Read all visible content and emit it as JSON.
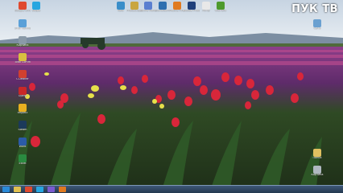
{
  "watermark": "ПУК ТВ",
  "desktop_icons_top": [
    {
      "label": "Google Chrome",
      "icon": "chrome-icon",
      "color": "#e04a2f"
    },
    {
      "label": "Skype",
      "icon": "skype-icon",
      "color": "#27a6e0"
    },
    {
      "label": "Kodi",
      "icon": "kodi-icon",
      "color": "#3a8ec9"
    },
    {
      "label": "Photoscape",
      "icon": "photoscape-icon",
      "color": "#c9a640"
    },
    {
      "label": "Movie Maker",
      "icon": "movie-maker-icon",
      "color": "#5a7fd0"
    },
    {
      "label": "Bandicam",
      "icon": "bandicam-icon",
      "color": "#2e6fb0"
    },
    {
      "label": "Mozilla Firefox",
      "icon": "firefox-icon",
      "color": "#e07a20"
    },
    {
      "label": "Adobe Photoshop",
      "icon": "photoshop-icon",
      "color": "#1f3f7a"
    },
    {
      "label": "Aimp",
      "icon": "aimp-icon",
      "color": "#e8e8e8"
    },
    {
      "label": "Utorrent",
      "icon": "utorrent-icon",
      "color": "#4e9a2c"
    }
  ],
  "desktop_icons_left": [
    {
      "label": "Этот компьютер",
      "icon": "computer-icon",
      "color": "#5aa0d8"
    },
    {
      "label": "Корзина",
      "icon": "recycle-bin-icon",
      "color": "#8a9aa8"
    },
    {
      "label": "Total Commander",
      "icon": "total-commander-icon",
      "color": "#d8c040"
    },
    {
      "label": "CCleaner",
      "icon": "ccleaner-icon",
      "color": "#d04030"
    },
    {
      "label": "Opera",
      "icon": "opera-icon",
      "color": "#c82828"
    },
    {
      "label": "Яндекс",
      "icon": "yandex-icon",
      "color": "#e8b020"
    },
    {
      "label": "Steam",
      "icon": "steam-icon",
      "color": "#1c3a5a"
    },
    {
      "label": "Word",
      "icon": "word-icon",
      "color": "#2b5ba8"
    },
    {
      "label": "Excel",
      "icon": "excel-icon",
      "color": "#2a8a40"
    }
  ],
  "desktop_icons_right": [
    {
      "label": "Сеть",
      "icon": "network-icon",
      "color": "#6aa0d0"
    },
    {
      "label": "Папка",
      "icon": "folder-icon",
      "color": "#e0c060"
    },
    {
      "label": "Корзина",
      "icon": "recycle-bin-right-icon",
      "color": "#b0b8c0"
    }
  ],
  "taskbar": {
    "apps": [
      {
        "icon": "start-icon",
        "color": "#2a8ad8"
      },
      {
        "icon": "explorer-icon",
        "color": "#e0c050"
      },
      {
        "icon": "chrome-taskbar-icon",
        "color": "#e04a2f"
      },
      {
        "icon": "skype-taskbar-icon",
        "color": "#27a6e0"
      },
      {
        "icon": "media-taskbar-icon",
        "color": "#7a5ad0"
      },
      {
        "icon": "firefox-taskbar-icon",
        "color": "#e07a20"
      }
    ],
    "clock_time": "",
    "clock_date": ""
  }
}
